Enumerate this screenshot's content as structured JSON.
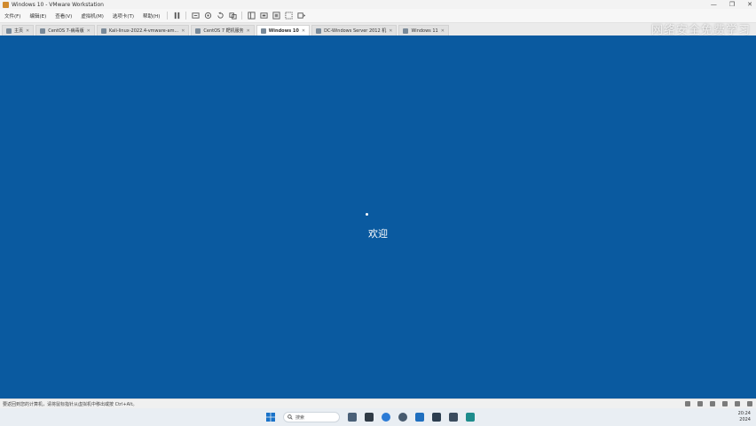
{
  "window": {
    "title": "Windows 10 - VMware Workstation",
    "controls": [
      "—",
      "❐",
      "✕"
    ]
  },
  "menu": {
    "items": [
      "文件(F)",
      "编辑(E)",
      "查看(V)",
      "虚拟机(M)",
      "选项卡(T)",
      "帮助(H)"
    ]
  },
  "toolbar": {
    "icons": [
      "pause-icon",
      "send-ctrl-alt-del-icon",
      "snapshot-icon",
      "revert-snapshot-icon",
      "manage-snapshots-icon",
      "show-library-icon",
      "thumbnail-icon",
      "fullscreen-icon",
      "unity-icon",
      "console-view-icon"
    ]
  },
  "tabs": [
    {
      "label": "主页",
      "active": false
    },
    {
      "label": "CentOS 7-病毒版",
      "active": false
    },
    {
      "label": "Kali-linux-2022.4-vmware-am...",
      "active": false
    },
    {
      "label": "CentOS 7 靶机服务",
      "active": false
    },
    {
      "label": "Windows 10",
      "active": true
    },
    {
      "label": "DC-Windows Server 2012 机",
      "active": false
    },
    {
      "label": "Windows 11",
      "active": false
    }
  ],
  "watermark": "网络安全免费学习",
  "vm": {
    "welcome_text": "欢迎",
    "background_color": "#0a5aa0"
  },
  "statusbar": {
    "text": "要返回到您的计算机，请将鼠标指针从虚拟机中移出或按 Ctrl+Alt。"
  },
  "taskbar": {
    "search_placeholder": "搜索",
    "apps": [
      "file-explorer-icon",
      "task-view-icon",
      "browser-icon",
      "vmware-icon",
      "store-icon",
      "terminal-icon",
      "settings-icon",
      "photos-icon"
    ],
    "time": "20:24",
    "date": "2024"
  }
}
